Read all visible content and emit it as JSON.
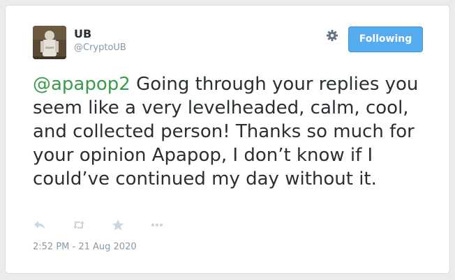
{
  "author": {
    "name": "UB",
    "handle": "@CryptoUB"
  },
  "follow_button": {
    "label": "Following"
  },
  "tweet": {
    "mention": "@apapop2",
    "body": "Going through your replies you seem like a very levelheaded, calm, cool, and collected person! Thanks so much for your opinion Apapop, I don’t know if I could’ve continued my day without it.",
    "timestamp": "2:52 PM - 21 Aug 2020"
  },
  "icons": {
    "settings": "gear-icon",
    "reply": "reply-icon",
    "retweet": "retweet-icon",
    "like": "star-icon",
    "more": "more-icon"
  },
  "colors": {
    "mention": "#3b9b4a",
    "button": "#55acee",
    "muted": "#8899a6",
    "text": "#292f33"
  }
}
